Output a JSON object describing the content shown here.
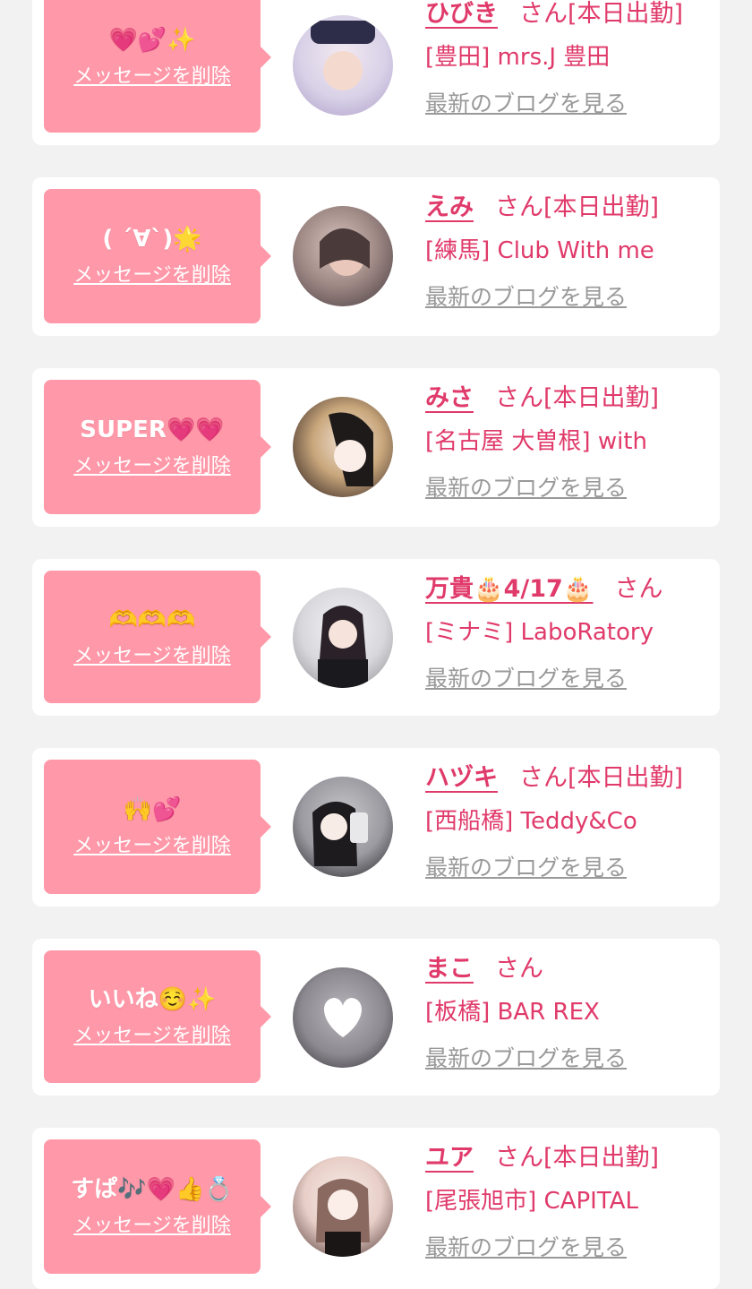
{
  "cards": [
    {
      "message": "💗💕✨",
      "delete_label": "メッセージを削除",
      "name": "ひびき",
      "san": "さん",
      "status": "[本日出勤]",
      "shop": "[豊田] mrs.J 豊田",
      "blog_label": "最新のブログを見る",
      "avatar_colors": [
        "#d9d2e8",
        "#b7a9cf"
      ]
    },
    {
      "message": "( ´∀`)🌟",
      "delete_label": "メッセージを削除",
      "name": "えみ",
      "san": "さん",
      "status": "[本日出勤]",
      "shop": "[練馬] Club With me",
      "blog_label": "最新のブログを見る",
      "avatar_colors": [
        "#a08a86",
        "#5b4d50"
      ]
    },
    {
      "message": "SUPER💗💗",
      "delete_label": "メッセージを削除",
      "name": "みさ",
      "san": "さん",
      "status": "[本日出勤]",
      "shop": "[名古屋 大曽根] with",
      "blog_label": "最新のブログを見る",
      "avatar_colors": [
        "#c9a77c",
        "#3b2b26"
      ]
    },
    {
      "message": "🫶🫶🫶",
      "delete_label": "メッセージを削除",
      "name": "万貴🎂4/17🎂",
      "san": "さん",
      "status": "",
      "shop": "[ミナミ] LaboRatory",
      "blog_label": "最新のブログを見る",
      "avatar_colors": [
        "#d8d8dc",
        "#2a2228"
      ]
    },
    {
      "message": "🙌💕",
      "delete_label": "メッセージを削除",
      "name": "ハヅキ",
      "san": "さん",
      "status": "[本日出勤]",
      "shop": "[西船橋] Teddy&Co",
      "blog_label": "最新のブログを見る",
      "avatar_colors": [
        "#9a9aa0",
        "#3c3a3f"
      ]
    },
    {
      "message": "いいね☺️✨",
      "delete_label": "メッセージを削除",
      "name": "まこ",
      "san": "さん",
      "status": "",
      "shop": "[板橋] BAR REX",
      "blog_label": "最新のブログを見る",
      "avatar_colors": [
        "#8c8a90",
        "#3a383d"
      ]
    },
    {
      "message": "すぱ🎶💗👍💍",
      "delete_label": "メッセージを削除",
      "name": "ユア",
      "san": "さん",
      "status": "[本日出勤]",
      "shop": "[尾張旭市] CAPITAL",
      "blog_label": "最新のブログを見る",
      "avatar_colors": [
        "#e8cfc8",
        "#6d5450"
      ]
    }
  ]
}
